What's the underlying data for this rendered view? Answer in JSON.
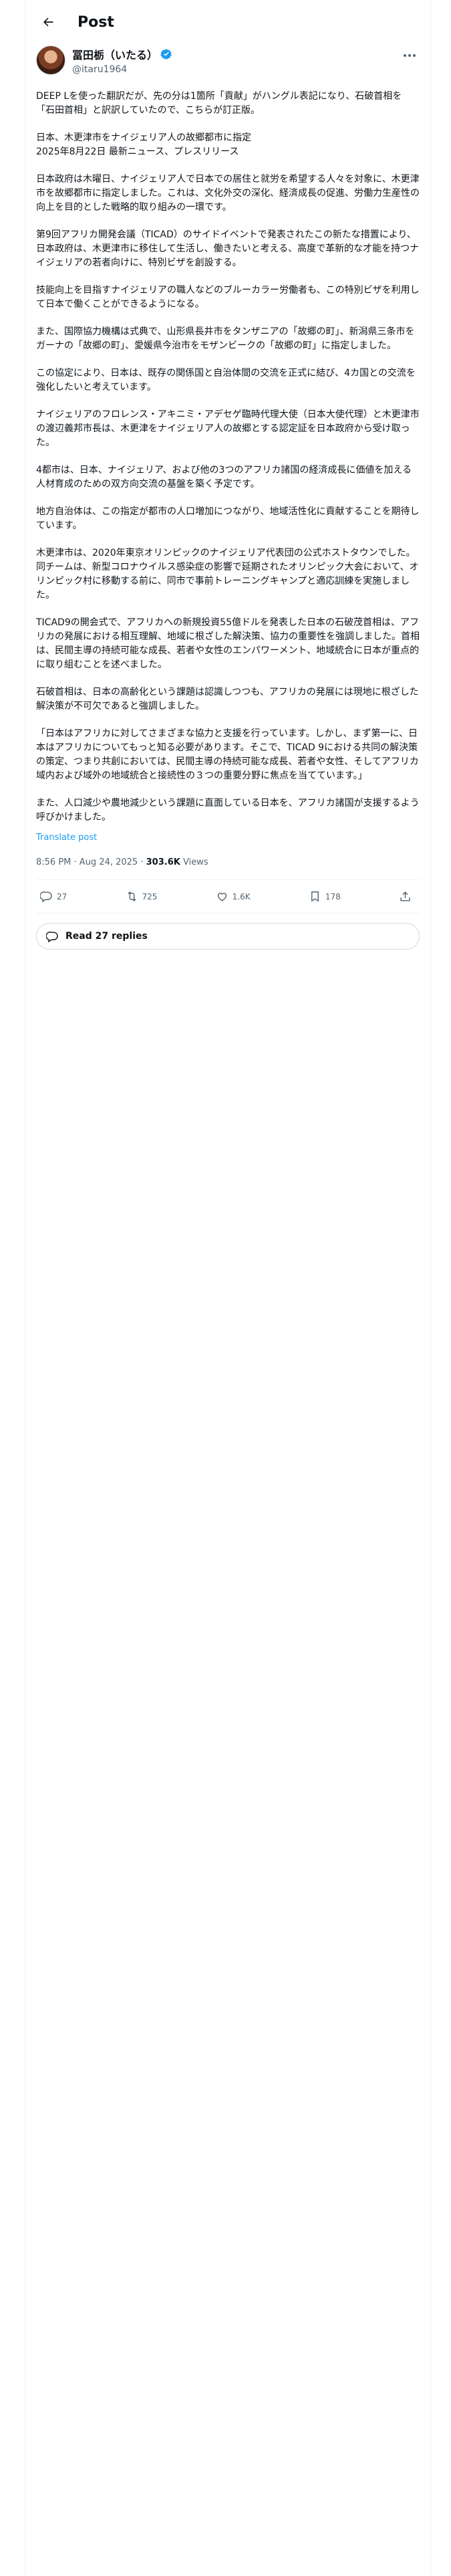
{
  "header": {
    "title": "Post"
  },
  "author": {
    "name": "冨田栃（いたる）",
    "handle": "@itaru1964"
  },
  "post": {
    "paragraphs": [
      "DEEP Lを使った翻訳だが、先の分は1箇所「貢献」がハングル表記になり、石破首相を「石田首相」と訳訳していたので、こちらが訂正版。",
      "日本、木更津市をナイジェリア人の故郷都市に指定\n2025年8月22日 最新ニュース、プレスリリース",
      "日本政府は木曜日、ナイジェリア人で日本での居住と就労を希望する人々を対象に、木更津市を故郷都市に指定しました。これは、文化外交の深化、経済成長の促進、労働力生産性の向上を目的とした戦略的取り組みの一環です。",
      "第9回アフリカ開発会議（TICAD）のサイドイベントで発表されたこの新たな措置により、日本政府は、木更津市に移住して生活し、働きたいと考える、高度で革新的な才能を持つナイジェリアの若者向けに、特別ビザを創設する。",
      "技能向上を目指すナイジェリアの職人などのブルーカラー労働者も、この特別ビザを利用して日本で働くことができるようになる。",
      "また、国際協力機構は式典で、山形県長井市をタンザニアの「故郷の町」、新潟県三条市をガーナの「故郷の町」、愛媛県今治市をモザンビークの「故郷の町」に指定しました。",
      "この協定により、日本は、既存の関係国と自治体間の交流を正式に結び、4カ国との交流を強化したいと考えています。",
      "ナイジェリアのフロレンス・アキニミ・アデセゲ臨時代理大使（日本大使代理）と木更津市の渡辺義邦市長は、木更津をナイジェリア人の故郷とする認定証を日本政府から受け取った。",
      "4都市は、日本、ナイジェリア、および他の3つのアフリカ諸国の経済成長に価値を加える人材育成のための双方向交流の基盤を築く予定です。",
      "地方自治体は、この指定が都市の人口増加につながり、地域活性化に貢献することを期待しています。",
      "木更津市は、2020年東京オリンピックのナイジェリア代表団の公式ホストタウンでした。同チームは、新型コロナウイルス感染症の影響で延期されたオリンピック大会において、オリンピック村に移動する前に、同市で事前トレーニングキャンプと適応訓練を実施しました。",
      "TICAD9の開会式で、アフリカへの新規投資55億ドルを発表した日本の石破茂首相は、アフリカの発展における相互理解、地域に根ざした解決策、協力の重要性を強調しました。首相は、民間主導の持続可能な成長、若者や女性のエンパワーメント、地域統合に日本が重点的に取り組むことを述べました。",
      "石破首相は、日本の高齢化という課題は認識しつつも、アフリカの発展には現地に根ざした解決策が不可欠であると強調しました。",
      "「日本はアフリカに対してさまざまな協力と支援を行っています。しかし、まず第一に、日本はアフリカについてもっと知る必要があります。そこで、TICAD 9における共同の解決策の策定、つまり共創においては、民間主導の持続可能な成長、若者や女性、そしてアフリカ域内および域外の地域統合と接続性の３つの重要分野に焦点を当てています。」",
      "また、人口減少や農地減少という課題に直面している日本を、アフリカ諸国が支援するよう呼びかけました。"
    ],
    "translate_label": "Translate post",
    "time": "8:56 PM",
    "date": "Aug 24, 2025",
    "views_count": "303.6K",
    "views_label": "Views"
  },
  "actions": {
    "replies": "27",
    "reposts": "725",
    "likes": "1.6K",
    "bookmarks": "178"
  },
  "read_replies_label": "Read 27 replies",
  "icons": [
    "back-arrow-icon",
    "verified-badge-icon",
    "more-icon",
    "reply-icon",
    "repost-icon",
    "like-icon",
    "bookmark-icon",
    "share-icon",
    "replies-bubble-icon"
  ],
  "colors": {
    "accent": "#1d9bf0",
    "text": "#0f1419",
    "muted": "#536471",
    "border": "#eff3f4"
  }
}
